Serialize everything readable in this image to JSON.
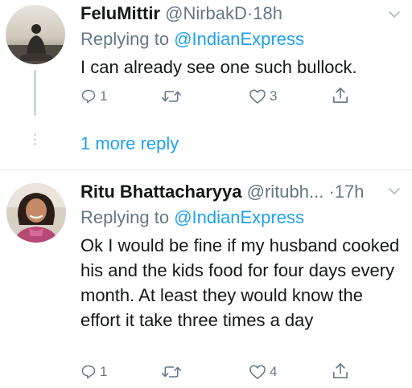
{
  "tweets": [
    {
      "display_name": "FeluMittir",
      "handle": "@NirbakD",
      "separator": "·",
      "time": "18h",
      "replying_prefix": "Replying to",
      "replying_to": "@IndianExpress",
      "text": "I can already see one such bullock.",
      "reply_count": "1",
      "retweet_count": "",
      "like_count": "3"
    },
    {
      "display_name": "Ritu Bhattacharyya",
      "handle": "@ritubh...",
      "separator": "·",
      "time": "17h",
      "replying_prefix": "Replying to",
      "replying_to": "@IndianExpress",
      "text": "Ok I would be fine if my husband cooked his and the kids food for four days every month. At least they would know the effort it take three times a day",
      "reply_count": "1",
      "retweet_count": "",
      "like_count": "4"
    }
  ],
  "thread": {
    "more_replies_label": "1 more reply"
  },
  "icons": {
    "reply": "reply-icon",
    "retweet": "retweet-icon",
    "like": "heart-icon",
    "share": "share-icon",
    "menu": "chevron-down-icon"
  },
  "colors": {
    "link": "#1da1f2",
    "secondary_text": "#657786",
    "primary_text": "#14171a",
    "divider": "#e6ecf0"
  }
}
